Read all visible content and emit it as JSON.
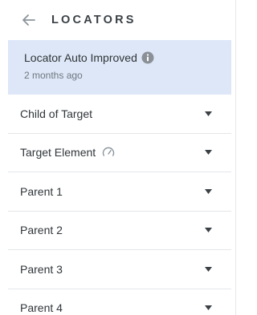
{
  "header": {
    "title": "LOCATORS",
    "back_icon": "arrow-left-icon"
  },
  "notice": {
    "title": "Locator Auto Improved",
    "subtitle": "2 months ago",
    "info_icon": "info-icon",
    "background": "#dde7f7"
  },
  "locators": [
    {
      "label": "Child of Target",
      "icon": ""
    },
    {
      "label": "Target Element",
      "icon": "gauge-icon"
    },
    {
      "label": "Parent 1",
      "icon": ""
    },
    {
      "label": "Parent 2",
      "icon": ""
    },
    {
      "label": "Parent 3",
      "icon": ""
    },
    {
      "label": "Parent 4",
      "icon": ""
    }
  ],
  "colors": {
    "text": "#30363a",
    "muted": "#6f7880",
    "divider": "#e3e6e9",
    "accent_background": "#dde7f7"
  }
}
